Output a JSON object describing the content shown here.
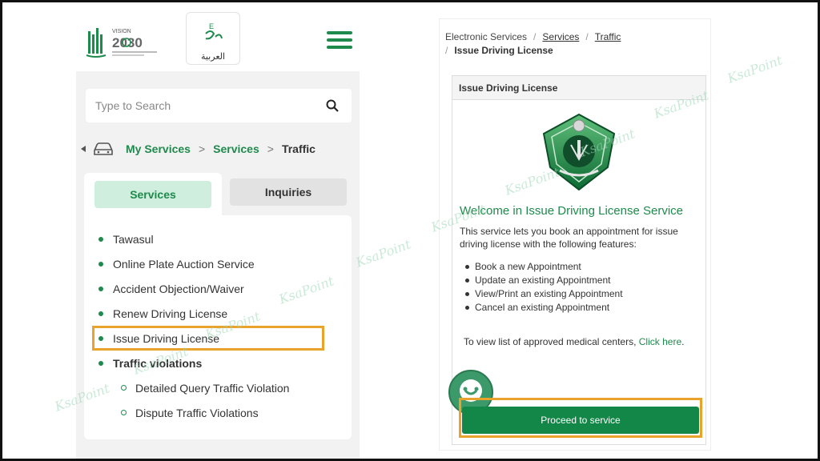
{
  "left": {
    "lang_label": "العربية",
    "search_placeholder": "Type to Search",
    "breadcrumb": {
      "my_services": "My Services",
      "sep1": ">",
      "services": "Services",
      "sep2": ">",
      "current": "Traffic"
    },
    "tabs": {
      "services": "Services",
      "inquiries": "Inquiries"
    },
    "service_items": [
      "Tawasul",
      "Online Plate Auction Service",
      "Accident Objection/Waiver",
      "Renew Driving License",
      "Issue Driving License",
      "Traffic violations",
      "Detailed Query Traffic Violation",
      "Dispute Traffic Violations"
    ]
  },
  "right": {
    "breadcrumb": {
      "root": "Electronic Services",
      "sep": "/",
      "services": "Services",
      "traffic": "Traffic",
      "current": "Issue Driving License"
    },
    "card_title": "Issue Driving License",
    "welcome_title": "Welcome in Issue Driving License Service",
    "intro": "This service lets you book an appointment for issue driving license with the following features:",
    "features": [
      "Book a new Appointment",
      "Update an existing Appointment",
      "View/Print an existing Appointment",
      "Cancel an existing Appointment"
    ],
    "medical_note": "To view list of approved medical centers, ",
    "click_here": "Click here",
    "period": ".",
    "proceed_label": "Proceed to service"
  },
  "watermark_text": "KsaPoint",
  "colors": {
    "brand_green": "#1e8a4c",
    "button_green": "#128747",
    "highlight_orange": "#e9a22a"
  }
}
